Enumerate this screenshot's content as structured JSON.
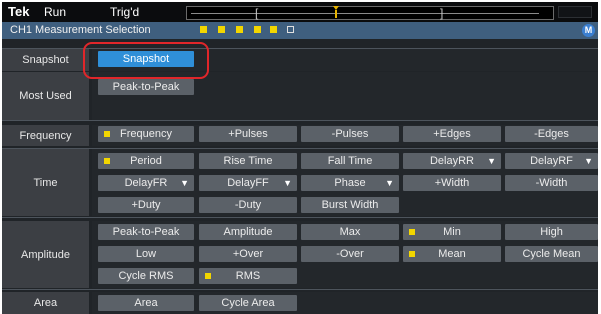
{
  "topbar": {
    "brand": "Tek",
    "run_status": "Run",
    "trigger_status": "Trig'd"
  },
  "header": {
    "title": "CH1 Measurement Selection",
    "badge": "M"
  },
  "categories": {
    "snapshot": "Snapshot",
    "most_used": "Most Used",
    "frequency": "Frequency",
    "time": "Time",
    "amplitude": "Amplitude",
    "area": "Area"
  },
  "buttons": {
    "snapshot": "Snapshot",
    "peak_to_peak_mu": "Peak-to-Peak",
    "frequency": "Frequency",
    "pos_pulses": "+Pulses",
    "neg_pulses": "-Pulses",
    "pos_edges": "+Edges",
    "neg_edges": "-Edges",
    "period": "Period",
    "rise_time": "Rise Time",
    "fall_time": "Fall Time",
    "delay_rr": "DelayRR",
    "delay_rf": "DelayRF",
    "delay_fr": "DelayFR",
    "delay_ff": "DelayFF",
    "phase": "Phase",
    "pos_width": "+Width",
    "neg_width": "-Width",
    "pos_duty": "+Duty",
    "neg_duty": "-Duty",
    "burst_width": "Burst Width",
    "peak_to_peak": "Peak-to-Peak",
    "amplitude": "Amplitude",
    "max": "Max",
    "min": "Min",
    "high": "High",
    "low": "Low",
    "pos_over": "+Over",
    "neg_over": "-Over",
    "mean": "Mean",
    "cycle_mean": "Cycle Mean",
    "cycle_rms": "Cycle RMS",
    "rms": "RMS",
    "area": "Area",
    "cycle_area": "Cycle Area"
  },
  "dropdown_glyph": "▼",
  "colors": {
    "selected_indicator": "#f2d600",
    "active_button": "#2f8fd8",
    "header": "#3f5f7f",
    "annotation_ring": "#e0262a"
  }
}
